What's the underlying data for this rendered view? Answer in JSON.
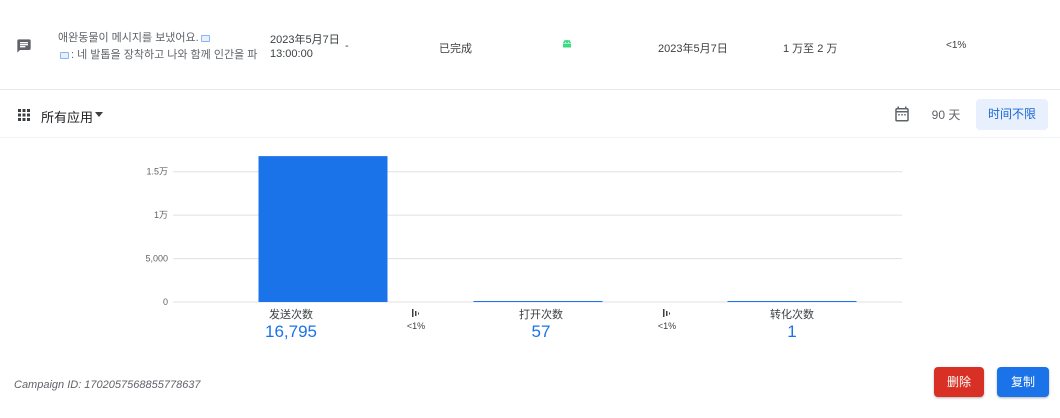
{
  "campaign_row": {
    "icon": "message-icon",
    "message_line1": "애완동물이 메시지를 보냈어요.",
    "message_line2": ": 네 발톱을 장착하고 나와 함께 인간을 파괴해",
    "scheduled_date": "2023年5月7日",
    "scheduled_time": "13:00:00",
    "dash": "-",
    "status": "已完成",
    "platform_icon": "android-icon",
    "platform_color": "#3ddc84",
    "end_date": "2023年5月7日",
    "audience_range": "1 万至 2 万",
    "conversion_rate": "<1%"
  },
  "toolbar": {
    "apps_icon": "grid-icon",
    "apps_label": "所有应用",
    "calendar_icon": "calendar-icon",
    "days_label": "90 天",
    "nolimit_label": "时间不限"
  },
  "chart_data": {
    "type": "bar",
    "ylim": [
      0,
      17500
    ],
    "y_ticks": [
      0,
      5000,
      10000,
      15000
    ],
    "y_tick_labels": [
      "0",
      "5,000",
      "1万",
      "1.5万"
    ],
    "grid": true,
    "categories": [
      "发送次数",
      "打开次数",
      "转化次数"
    ],
    "values": [
      16795,
      57,
      1
    ],
    "bar_color": "#1a73e8",
    "value_labels": [
      "16,795",
      "57",
      "1"
    ],
    "step_rates": [
      "<1%",
      "<1%"
    ]
  },
  "footer": {
    "campaign_id": "Campaign ID: 1702057568855778637",
    "delete_label": "删除",
    "delete_color": "#d93025",
    "copy_label": "复制",
    "copy_color": "#1a73e8"
  }
}
